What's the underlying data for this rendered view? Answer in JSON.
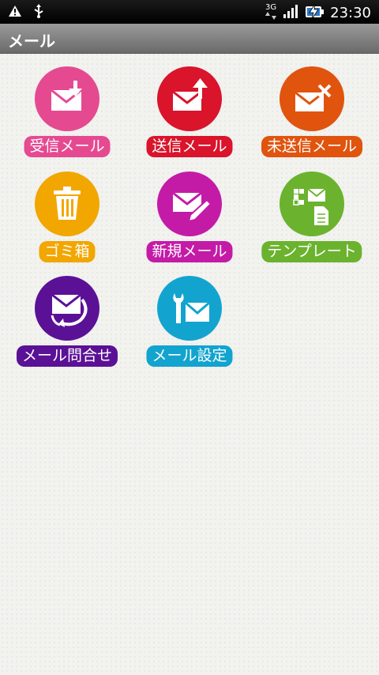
{
  "status_bar": {
    "time": "23:30",
    "network": "3G",
    "icons": [
      "warning-icon",
      "usb-icon",
      "network-3g-icon",
      "signal-icon",
      "battery-charging-icon"
    ]
  },
  "header": {
    "title": "メール"
  },
  "tiles": [
    {
      "label": "受信メール",
      "color": "#e54a91",
      "icon": "inbox-mail-icon"
    },
    {
      "label": "送信メール",
      "color": "#d9142b",
      "icon": "send-mail-icon"
    },
    {
      "label": "未送信メール",
      "color": "#e0540e",
      "icon": "unsent-mail-icon"
    },
    {
      "label": "ゴミ箱",
      "color": "#f2a600",
      "icon": "trash-icon"
    },
    {
      "label": "新規メール",
      "color": "#c41ba7",
      "icon": "new-mail-icon"
    },
    {
      "label": "テンプレート",
      "color": "#6bb32e",
      "icon": "template-icon"
    },
    {
      "label": "メール問合せ",
      "color": "#5b1196",
      "icon": "mail-inquiry-icon"
    },
    {
      "label": "メール設定",
      "color": "#12a4cf",
      "icon": "mail-settings-icon"
    }
  ]
}
